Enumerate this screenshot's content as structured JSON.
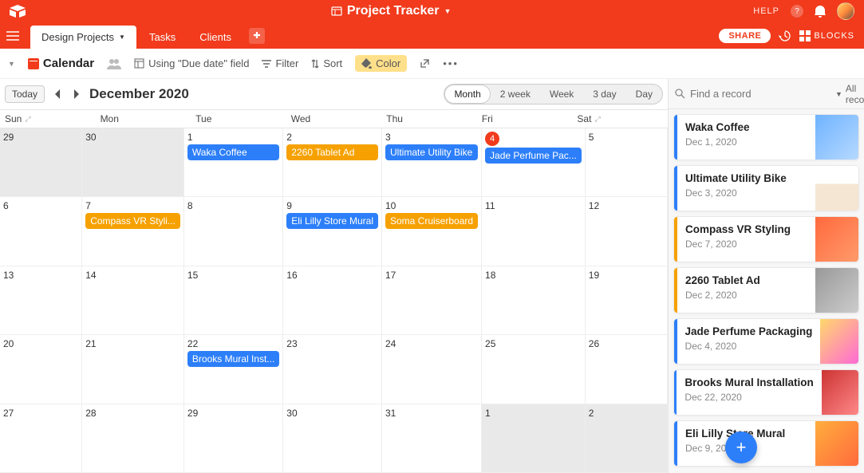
{
  "header": {
    "workspace_title": "Project Tracker",
    "help_label": "HELP"
  },
  "tabs": {
    "items": [
      {
        "label": "Design Projects",
        "active": true,
        "has_caret": true
      },
      {
        "label": "Tasks",
        "active": false
      },
      {
        "label": "Clients",
        "active": false
      }
    ],
    "share_label": "SHARE",
    "blocks_label": "BLOCKS"
  },
  "toolbar": {
    "view_name": "Calendar",
    "using_field": "Using \"Due date\" field",
    "filter_label": "Filter",
    "sort_label": "Sort",
    "color_label": "Color"
  },
  "calendar": {
    "today_label": "Today",
    "month_title": "December 2020",
    "ranges": [
      "Month",
      "2 week",
      "Week",
      "3 day",
      "Day"
    ],
    "active_range": "Month",
    "dow": [
      "Sun",
      "Mon",
      "Tue",
      "Wed",
      "Thu",
      "Fri",
      "Sat"
    ],
    "cells": [
      {
        "n": "29",
        "other": true
      },
      {
        "n": "30",
        "other": true
      },
      {
        "n": "1",
        "events": [
          {
            "t": "Waka Coffee",
            "c": "blue"
          }
        ]
      },
      {
        "n": "2",
        "events": [
          {
            "t": "2260 Tablet Ad",
            "c": "orange"
          }
        ]
      },
      {
        "n": "3",
        "events": [
          {
            "t": "Ultimate Utility Bike",
            "c": "blue"
          }
        ]
      },
      {
        "n": "4",
        "today": true,
        "events": [
          {
            "t": "Jade Perfume Pac...",
            "c": "blue"
          }
        ]
      },
      {
        "n": "5"
      },
      {
        "n": "6"
      },
      {
        "n": "7",
        "events": [
          {
            "t": "Compass VR Styli...",
            "c": "orange"
          }
        ]
      },
      {
        "n": "8"
      },
      {
        "n": "9",
        "events": [
          {
            "t": "Eli Lilly Store Mural",
            "c": "blue"
          }
        ]
      },
      {
        "n": "10",
        "events": [
          {
            "t": "Soma Cruiserboard",
            "c": "orange"
          }
        ]
      },
      {
        "n": "11"
      },
      {
        "n": "12"
      },
      {
        "n": "13"
      },
      {
        "n": "14"
      },
      {
        "n": "15"
      },
      {
        "n": "16"
      },
      {
        "n": "17"
      },
      {
        "n": "18"
      },
      {
        "n": "19"
      },
      {
        "n": "20"
      },
      {
        "n": "21"
      },
      {
        "n": "22",
        "events": [
          {
            "t": "Brooks Mural Inst...",
            "c": "blue"
          }
        ]
      },
      {
        "n": "23"
      },
      {
        "n": "24"
      },
      {
        "n": "25"
      },
      {
        "n": "26"
      },
      {
        "n": "27"
      },
      {
        "n": "28"
      },
      {
        "n": "29"
      },
      {
        "n": "30"
      },
      {
        "n": "31"
      },
      {
        "n": "1",
        "other": true
      },
      {
        "n": "2",
        "other": true
      }
    ]
  },
  "side": {
    "search_placeholder": "Find a record",
    "all_records_label": "All records",
    "records": [
      {
        "title": "Waka Coffee",
        "date": "Dec 1, 2020",
        "bar": "b",
        "thumb": "thumb1"
      },
      {
        "title": "Ultimate Utility Bike",
        "date": "Dec 3, 2020",
        "bar": "b",
        "thumb": "thumb2"
      },
      {
        "title": "Compass VR Styling",
        "date": "Dec 7, 2020",
        "bar": "o",
        "thumb": "thumb3"
      },
      {
        "title": "2260 Tablet Ad",
        "date": "Dec 2, 2020",
        "bar": "o",
        "thumb": "thumb4"
      },
      {
        "title": "Jade Perfume Packaging",
        "date": "Dec 4, 2020",
        "bar": "b",
        "thumb": "thumb5"
      },
      {
        "title": "Brooks Mural Installation",
        "date": "Dec 22, 2020",
        "bar": "b",
        "thumb": "thumb6"
      },
      {
        "title": "Eli Lilly Store Mural",
        "date": "Dec 9, 2020",
        "bar": "b",
        "thumb": "thumb7"
      }
    ]
  }
}
